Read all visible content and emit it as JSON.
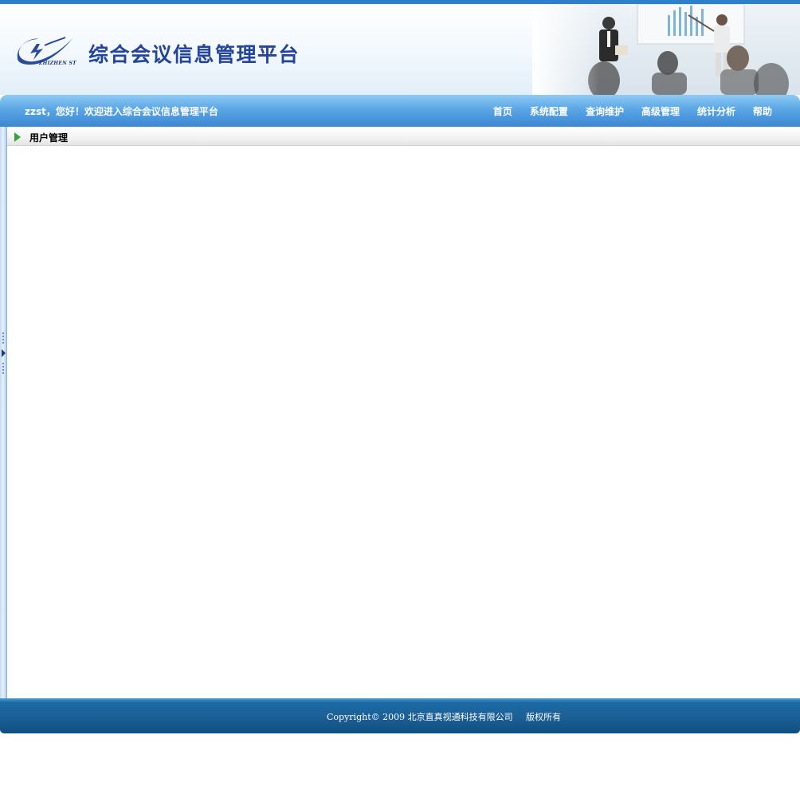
{
  "header": {
    "platform_title": "综合会议信息管理平台",
    "logo_text": "ZHIZHEN ST",
    "logo_icon": "lightning-swoosh-logo",
    "photo": "meeting-presentation-photo"
  },
  "navbar": {
    "welcome": "zzst，您好！欢迎进入综合会议信息管理平台",
    "menu": [
      {
        "label": "首页"
      },
      {
        "label": "系统配置"
      },
      {
        "label": "查询维护"
      },
      {
        "label": "高级管理"
      },
      {
        "label": "统计分析"
      },
      {
        "label": "帮助"
      }
    ]
  },
  "main": {
    "section_title": "用户管理",
    "title_icon": "green-triangle-icon",
    "side_toggle_icon": "collapse-arrow-icon"
  },
  "footer": {
    "copyright": "Copyright© 2009 北京直真视通科技有限公司",
    "rights": "版权所有"
  },
  "colors": {
    "top_strip": "#2a7fcf",
    "nav_top": "#8fcaf3",
    "nav_bottom": "#3c87d2",
    "title_color": "#23449b",
    "footer": "#1c5f94",
    "title_arrow": "#3aa13a"
  }
}
